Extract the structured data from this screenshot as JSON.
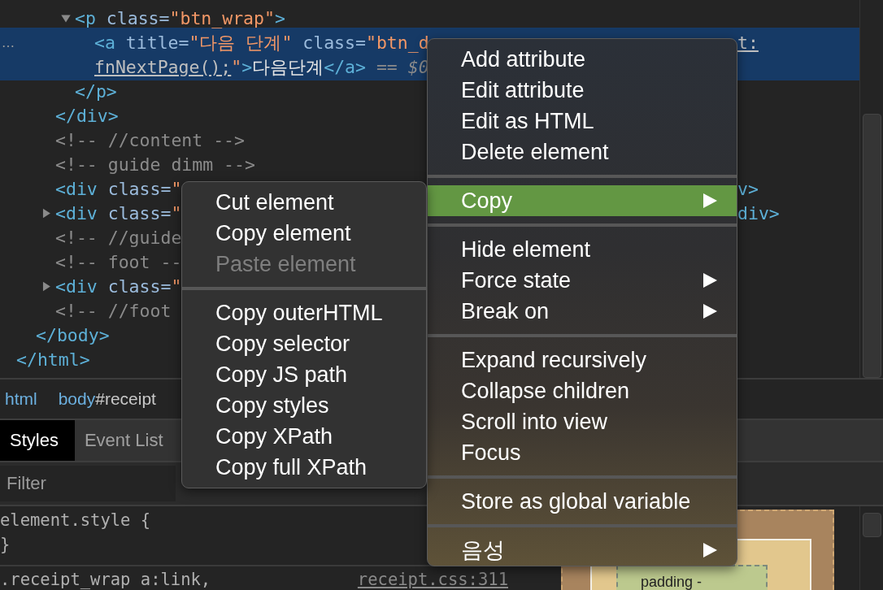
{
  "elements_tree": [
    {
      "children": [
        {
          "children": [
            {
              "children": [
                {
                  "line": [
                    {
                      "kind": "tag",
                      "text": "<p"
                    },
                    {
                      "kind": "attr",
                      "text": " class="
                    },
                    {
                      "kind": "value",
                      "text": "\"btn_wrap\""
                    },
                    {
                      "kind": "tag",
                      "text": ">"
                    }
                  ],
                  "expanded": true,
                  "selected": false,
                  "children": [
                    {
                      "gutter": "…",
                      "selected": true,
                      "line": [
                        {
                          "kind": "tag",
                          "text": "<a"
                        },
                        {
                          "kind": "attr",
                          "text": " title="
                        },
                        {
                          "kind": "value",
                          "text": "\"다음 단계\""
                        },
                        {
                          "kind": "attr",
                          "text": " class="
                        },
                        {
                          "kind": "value",
                          "text": "\"btn_d"
                        }
                      ],
                      "right": [
                        {
                          "kind": "link",
                          "text": "t:"
                        }
                      ],
                      "wrap": [
                        {
                          "kind": "link",
                          "text": "fnNextPage();"
                        },
                        {
                          "kind": "value",
                          "text": "\""
                        },
                        {
                          "kind": "tag",
                          "text": ">"
                        },
                        {
                          "kind": "text",
                          "text": "다음단계"
                        },
                        {
                          "kind": "tag",
                          "text": "</a>"
                        },
                        {
                          "kind": "hint",
                          "text": " == $0"
                        }
                      ]
                    }
                  ]
                },
                {
                  "selected": false,
                  "line": [
                    {
                      "kind": "tag",
                      "text": "</p>"
                    }
                  ]
                }
              ]
            },
            {
              "selected": false,
              "line": [
                {
                  "kind": "tag",
                  "text": "</div>"
                }
              ]
            },
            {
              "selected": false,
              "line": [
                {
                  "kind": "comment",
                  "text": "<!-- //content -->"
                }
              ]
            },
            {
              "selected": false,
              "line": [
                {
                  "kind": "comment",
                  "text": "<!-- guide dimm -->"
                }
              ]
            },
            {
              "selected": false,
              "line": [
                {
                  "kind": "tag",
                  "text": "<div"
                },
                {
                  "kind": "attr",
                  "text": " class="
                },
                {
                  "kind": "value",
                  "text": "\""
                }
              ],
              "right": [
                {
                  "kind": "tag",
                  "text": "v>"
                }
              ]
            },
            {
              "selected": false,
              "expanded": false,
              "line": [
                {
                  "kind": "tag",
                  "text": "<div"
                },
                {
                  "kind": "attr",
                  "text": " class="
                },
                {
                  "kind": "value",
                  "text": "\""
                }
              ],
              "right": [
                {
                  "kind": "tag",
                  "text": "div>"
                }
              ]
            },
            {
              "selected": false,
              "line": [
                {
                  "kind": "comment",
                  "text": "<!-- //guide"
                }
              ]
            },
            {
              "selected": false,
              "line": [
                {
                  "kind": "comment",
                  "text": "<!-- foot --"
                }
              ]
            },
            {
              "selected": false,
              "expanded": false,
              "line": [
                {
                  "kind": "tag",
                  "text": "<div"
                },
                {
                  "kind": "attr",
                  "text": " class="
                },
                {
                  "kind": "value",
                  "text": "\""
                }
              ]
            },
            {
              "selected": false,
              "line": [
                {
                  "kind": "comment",
                  "text": "<!-- //foot "
                }
              ]
            }
          ]
        },
        {
          "selected": false,
          "line": [
            {
              "kind": "tag",
              "text": "</body>"
            }
          ]
        }
      ]
    },
    {
      "selected": false,
      "line": [
        {
          "kind": "tag",
          "text": "</html>"
        }
      ]
    }
  ],
  "breadcrumbs": [
    {
      "tag": "html"
    },
    {
      "tag": "body",
      "id": "#receipt"
    }
  ],
  "tabs": [
    {
      "label": "Styles",
      "selected": true
    },
    {
      "label": "Event List",
      "selected": false
    }
  ],
  "filter": {
    "placeholder": "Filter"
  },
  "styles": {
    "rules": [
      {
        "lines": [
          "element.style {",
          "}"
        ]
      },
      {
        "lines": [
          ".receipt_wrap a:link,"
        ],
        "source": "receipt.css:311"
      }
    ],
    "box_model": {
      "label": "padding -"
    }
  },
  "context_menu": {
    "groups": [
      {
        "items": [
          {
            "label": "Add attribute",
            "selected": false,
            "has_submenu": false
          },
          {
            "label": "Edit attribute",
            "selected": false,
            "has_submenu": false
          },
          {
            "label": "Edit as HTML",
            "selected": false,
            "has_submenu": false
          },
          {
            "label": "Delete element",
            "selected": false,
            "has_submenu": false
          }
        ]
      },
      {
        "items": [
          {
            "label": "Copy",
            "selected": true,
            "has_submenu": true
          }
        ]
      },
      {
        "items": [
          {
            "label": "Hide element",
            "selected": false,
            "has_submenu": false
          },
          {
            "label": "Force state",
            "selected": false,
            "has_submenu": true
          },
          {
            "label": "Break on",
            "selected": false,
            "has_submenu": true
          }
        ]
      },
      {
        "items": [
          {
            "label": "Expand recursively",
            "selected": false,
            "has_submenu": false
          },
          {
            "label": "Collapse children",
            "selected": false,
            "has_submenu": false
          },
          {
            "label": "Scroll into view",
            "selected": false,
            "has_submenu": false
          },
          {
            "label": "Focus",
            "selected": false,
            "has_submenu": false
          }
        ]
      },
      {
        "items": [
          {
            "label": "Store as global variable",
            "selected": false,
            "has_submenu": false
          }
        ]
      },
      {
        "items": [
          {
            "label": "음성",
            "selected": false,
            "has_submenu": true
          }
        ]
      }
    ]
  },
  "copy_submenu": {
    "groups": [
      {
        "items": [
          {
            "label": "Cut element",
            "disabled": false
          },
          {
            "label": "Copy element",
            "disabled": false
          },
          {
            "label": "Paste element",
            "disabled": true
          }
        ]
      },
      {
        "items": [
          {
            "label": "Copy outerHTML",
            "disabled": false
          },
          {
            "label": "Copy selector",
            "disabled": false
          },
          {
            "label": "Copy JS path",
            "disabled": false
          },
          {
            "label": "Copy styles",
            "disabled": false
          },
          {
            "label": "Copy XPath",
            "disabled": false
          },
          {
            "label": "Copy full XPath",
            "disabled": false
          }
        ]
      }
    ]
  }
}
